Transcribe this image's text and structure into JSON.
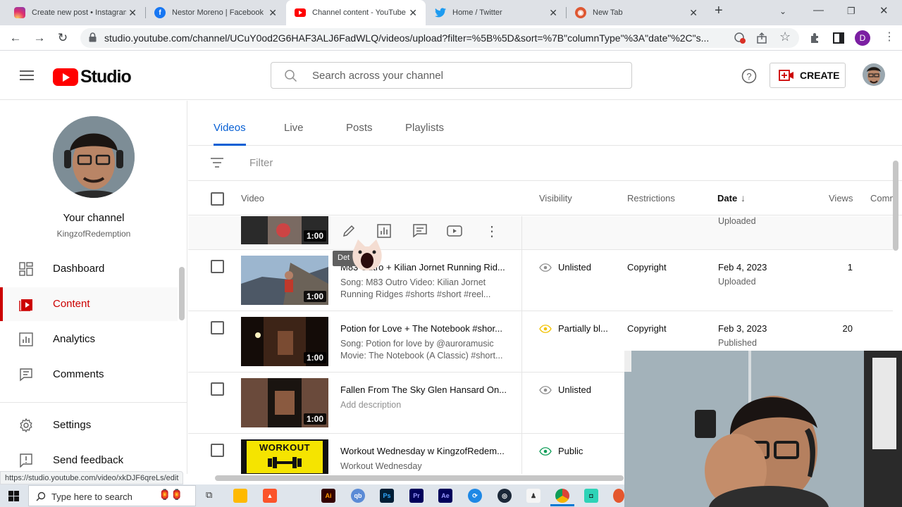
{
  "browser": {
    "tabs": [
      {
        "title": "Create new post • Instagram",
        "icon": "instagram-icon"
      },
      {
        "title": "Nestor Moreno | Facebook",
        "icon": "facebook-icon"
      },
      {
        "title": "Channel content - YouTube",
        "icon": "youtube-icon"
      },
      {
        "title": "Home / Twitter",
        "icon": "twitter-icon"
      },
      {
        "title": "New Tab",
        "icon": "duckduckgo-icon"
      }
    ],
    "url": "studio.youtube.com/channel/UCuY0od2G6HAF3ALJ6FadWLQ/videos/upload?filter=%5B%5D&sort=%7B\"columnType\"%3A\"date\"%2C\"s...",
    "profile_initial": "D",
    "status_url": "https://studio.youtube.com/video/xkDJF6qreLs/edit"
  },
  "header": {
    "logo_text": "Studio",
    "search_placeholder": "Search across your channel",
    "create_label": "CREATE"
  },
  "sidebar": {
    "your_channel": "Your channel",
    "handle": "KingzofRedemption",
    "items": [
      {
        "label": "Dashboard",
        "icon": "dashboard-icon"
      },
      {
        "label": "Content",
        "icon": "content-icon"
      },
      {
        "label": "Analytics",
        "icon": "analytics-icon"
      },
      {
        "label": "Comments",
        "icon": "comments-icon"
      },
      {
        "label": "Settings",
        "icon": "gear-icon"
      },
      {
        "label": "Send feedback",
        "icon": "feedback-icon"
      }
    ]
  },
  "content": {
    "tabs": [
      "Videos",
      "Live",
      "Posts",
      "Playlists"
    ],
    "filter_label": "Filter",
    "columns": {
      "video": "Video",
      "visibility": "Visibility",
      "restrictions": "Restrictions",
      "date": "Date",
      "views": "Views",
      "comments": "Comm"
    },
    "hover_row": {
      "duration": "1:00",
      "status": "Uploaded",
      "tooltip": "Det"
    },
    "rows": [
      {
        "title": "M83 Outro + Kilian Jornet Running Rid...",
        "description": "Song: M83 Outro Video: Kilian Jornet Running Ridges #shorts #short #reel...",
        "duration": "1:00",
        "visibility": "Unlisted",
        "restrictions": "Copyright",
        "date": "Feb 4, 2023",
        "status": "Uploaded",
        "views": "1"
      },
      {
        "title": "Potion for Love + The Notebook #shor...",
        "description": "Song: Potion for love by @auroramusic Movie: The Notebook (A Classic) #short...",
        "duration": "1:00",
        "visibility": "Partially bl...",
        "restrictions": "Copyright",
        "date": "Feb 3, 2023",
        "status": "Published",
        "views": "20"
      },
      {
        "title": "Fallen From The Sky Glen Hansard On...",
        "description": "Add description",
        "duration": "1:00",
        "visibility": "Unlisted",
        "restrictions": "",
        "date": "",
        "status": "",
        "views": ""
      },
      {
        "title": "Workout Wednesday w KingzofRedem...",
        "description": "Workout Wednesday",
        "duration": "",
        "visibility": "Public",
        "restrictions": "",
        "date": "",
        "status": "",
        "views": "",
        "thumb_text": "WORKOUT"
      }
    ]
  },
  "taskbar": {
    "search_placeholder": "Type here to search",
    "apps": [
      "Ai",
      "Ps",
      "Pr",
      "Ae"
    ]
  },
  "colors": {
    "youtube_red": "#ff0000",
    "content_active": "#cc0000",
    "link_blue": "#065fd4",
    "public_green": "#0f9d58",
    "partial_yellow": "#f2c200"
  }
}
